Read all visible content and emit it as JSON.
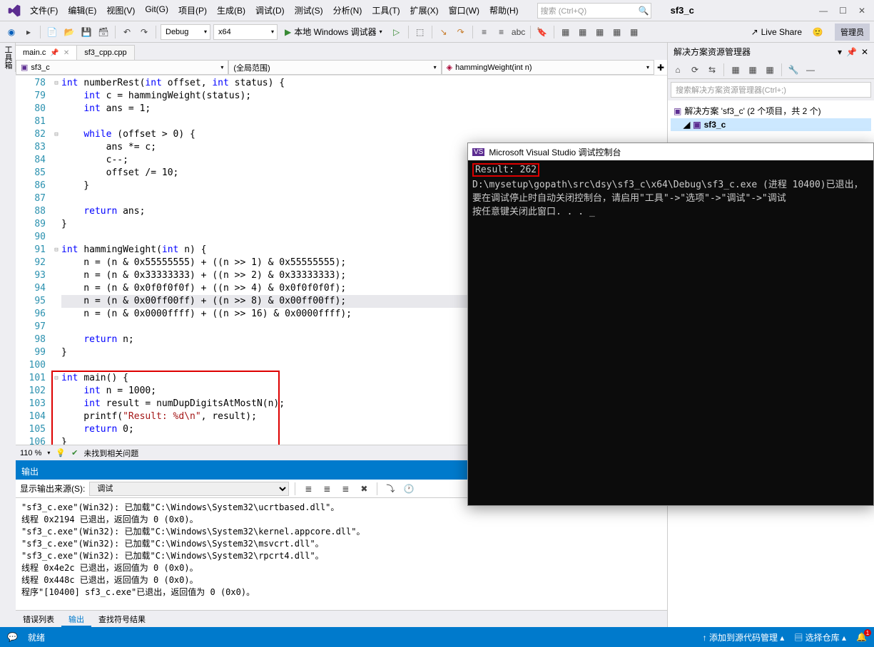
{
  "menu": [
    "文件(F)",
    "编辑(E)",
    "视图(V)",
    "Git(G)",
    "项目(P)",
    "生成(B)",
    "调试(D)",
    "测试(S)",
    "分析(N)",
    "工具(T)",
    "扩展(X)",
    "窗口(W)",
    "帮助(H)"
  ],
  "search_placeholder": "搜索 (Ctrl+Q)",
  "project_name": "sf3_c",
  "admin_label": "管理员",
  "toolbar": {
    "config": "Debug",
    "platform": "x64",
    "debug_label": "本地 Windows 调试器",
    "live_share": "Live Share"
  },
  "left_tool_label": "工具箱",
  "tabs": {
    "active": "main.c",
    "other": "sf3_cpp.cpp"
  },
  "nav": {
    "scope": "sf3_c",
    "region": "(全局范围)",
    "member": "hammingWeight(int n)"
  },
  "code_start_line": 78,
  "code_lines": [
    {
      "fold": "⊟",
      "t": [
        "kw:int",
        " ",
        "fn:numberRest",
        "(",
        "kw:int",
        " offset, ",
        "kw:int",
        " status) {"
      ]
    },
    {
      "t": [
        "    ",
        "kw:int",
        " c = hammingWeight(status);"
      ]
    },
    {
      "t": [
        "    ",
        "kw:int",
        " ans = ",
        "num:1",
        ";"
      ]
    },
    {
      "t": [
        ""
      ]
    },
    {
      "fold": "⊟",
      "t": [
        "    ",
        "kw:while",
        " (offset > ",
        "num:0",
        ") {"
      ]
    },
    {
      "t": [
        "        ans *= c;"
      ]
    },
    {
      "t": [
        "        c--;"
      ]
    },
    {
      "t": [
        "        offset /= ",
        "num:10",
        ";"
      ]
    },
    {
      "t": [
        "    }"
      ]
    },
    {
      "t": [
        ""
      ]
    },
    {
      "t": [
        "    ",
        "kw:return",
        " ans;"
      ]
    },
    {
      "t": [
        "}"
      ]
    },
    {
      "t": [
        ""
      ]
    },
    {
      "fold": "⊟",
      "t": [
        "kw:int",
        " ",
        "fn:hammingWeight",
        "(",
        "kw:int",
        " n) {"
      ]
    },
    {
      "t": [
        "    n = (n & 0x55555555) + ((n >> ",
        "num:1",
        ") & 0x55555555);"
      ]
    },
    {
      "t": [
        "    n = (n & 0x33333333) + ((n >> ",
        "num:2",
        ") & 0x33333333);"
      ]
    },
    {
      "t": [
        "    n = (n & 0x0f0f0f0f) + ((n >> ",
        "num:4",
        ") & 0x0f0f0f0f);"
      ]
    },
    {
      "hl": true,
      "t": [
        "    n = (n & 0x00ff00ff) + ((n >> ",
        "num:8",
        ") & 0x00ff00ff);"
      ]
    },
    {
      "t": [
        "    n = (n & 0x0000ffff) + ((n >> ",
        "num:16",
        ") & 0x0000ffff);"
      ]
    },
    {
      "t": [
        ""
      ]
    },
    {
      "t": [
        "    ",
        "kw:return",
        " n;"
      ]
    },
    {
      "t": [
        "}"
      ]
    },
    {
      "t": [
        ""
      ]
    },
    {
      "fold": "⊟",
      "t": [
        "kw:int",
        " ",
        "fn:main",
        "() {"
      ]
    },
    {
      "t": [
        "    ",
        "kw:int",
        " n = ",
        "num:1000",
        ";"
      ]
    },
    {
      "t": [
        "    ",
        "kw:int",
        " result = numDupDigitsAtMostN(n);"
      ]
    },
    {
      "t": [
        "    printf(",
        "str:\"Result: %d\\n\"",
        ", result);"
      ]
    },
    {
      "t": [
        "    ",
        "kw:return",
        " ",
        "num:0",
        ";"
      ]
    },
    {
      "t": [
        "}"
      ]
    }
  ],
  "main_box": {
    "from_line": 101,
    "to_line": 106
  },
  "zoom": "110 %",
  "issues_text": "未找到相关问题",
  "output": {
    "title": "输出",
    "src_label": "显示输出来源(S):",
    "src_value": "调试",
    "lines": [
      "\"sf3_c.exe\"(Win32): 已加载\"C:\\Windows\\System32\\ucrtbased.dll\"。",
      "线程 0x2194 已退出，返回值为 0 (0x0)。",
      "\"sf3_c.exe\"(Win32): 已加载\"C:\\Windows\\System32\\kernel.appcore.dll\"。",
      "\"sf3_c.exe\"(Win32): 已加载\"C:\\Windows\\System32\\msvcrt.dll\"。",
      "\"sf3_c.exe\"(Win32): 已加载\"C:\\Windows\\System32\\rpcrt4.dll\"。",
      "线程 0x4e2c 已退出，返回值为 0 (0x0)。",
      "线程 0x448c 已退出，返回值为 0 (0x0)。",
      "程序\"[10400] sf3_c.exe\"已退出，返回值为 0 (0x0)。"
    ]
  },
  "bottom_tabs": {
    "items": [
      "错误列表",
      "输出",
      "查找符号结果"
    ],
    "selected": 1
  },
  "solution": {
    "title": "解决方案资源管理器",
    "search_placeholder": "搜索解决方案资源管理器(Ctrl+;)",
    "root": "解决方案 'sf3_c' (2 个项目，共 2 个)",
    "project": "sf3_c"
  },
  "console": {
    "title": "Microsoft Visual Studio 调试控制台",
    "result": "Result: 262",
    "body": "\nD:\\mysetup\\gopath\\src\\dsy\\sf3_c\\x64\\Debug\\sf3_c.exe (进程 10400)已退出，\n要在调试停止时自动关闭控制台，请启用\"工具\"->\"选项\"->\"调试\"->\"调试\n按任意键关闭此窗口. . . _"
  },
  "status": {
    "ready": "就绪",
    "src_ctrl": "添加到源代码管理",
    "repo": "选择仓库"
  }
}
